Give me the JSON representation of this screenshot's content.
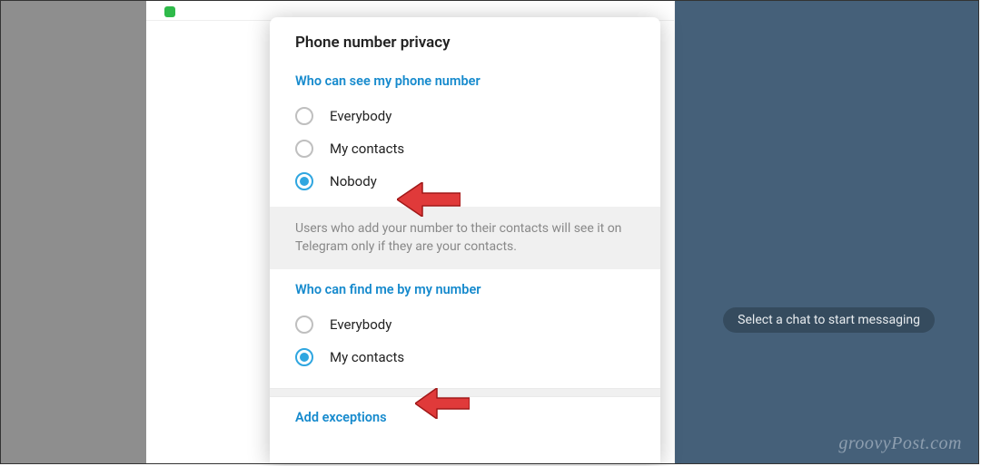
{
  "dialog": {
    "title": "Phone number privacy",
    "sections": [
      {
        "header": "Who can see my phone number",
        "options": [
          {
            "label": "Everybody",
            "selected": false
          },
          {
            "label": "My contacts",
            "selected": false
          },
          {
            "label": "Nobody",
            "selected": true
          }
        ]
      },
      {
        "header": "Who can find me by my number",
        "options": [
          {
            "label": "Everybody",
            "selected": false
          },
          {
            "label": "My contacts",
            "selected": true
          }
        ]
      }
    ],
    "info_text": "Users who add your number to their contacts will see it on Telegram only if they are your contacts.",
    "add_exceptions": "Add exceptions"
  },
  "chat_hint": "Select a chat to start messaging",
  "watermark": "groovyPost.com"
}
